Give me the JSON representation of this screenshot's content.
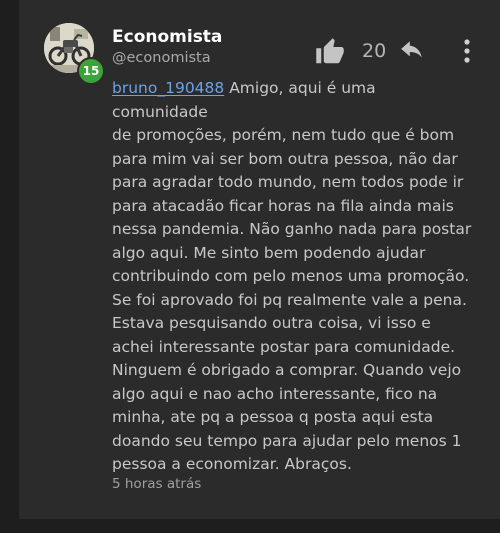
{
  "comment": {
    "author": {
      "name": "Economista",
      "handle": "@economista",
      "level": "15"
    },
    "actions": {
      "like_icon": "thumbs-up-icon",
      "like_count": "20",
      "reply_icon": "reply-arrow-icon",
      "more_icon": "more-vertical-icon"
    },
    "mention": "bruno_190488",
    "text": " Amigo, aqui é uma comunidade\nde promoções, porém, nem tudo que é bom\npara mim vai ser bom outra pessoa, não dar\npara agradar todo mundo, nem todos pode ir\npara atacadão ficar horas na fila ainda mais\nnessa pandemia. Não ganho nada para postar\nalgo aqui. Me sinto bem podendo ajudar\ncontribuindo com pelo menos uma promoção.\nSe foi aprovado foi pq realmente vale a pena.\nEstava pesquisando outra coisa, vi isso e\nachei interessante postar para comunidade.\nNinguem é obrigado a comprar. Quando vejo\nalgo aqui e nao acho interessante, fico na\nminha, ate pq a pessoa q posta aqui esta\ndoando seu tempo para ajudar pelo menos 1\npessoa a economizar. Abraços.",
    "timestamp": "5 horas atrás"
  },
  "colors": {
    "background": "#1e1e1e",
    "card": "#2b2b2b",
    "mention": "#6aa3e6",
    "level_badge": "#3ea33a"
  }
}
